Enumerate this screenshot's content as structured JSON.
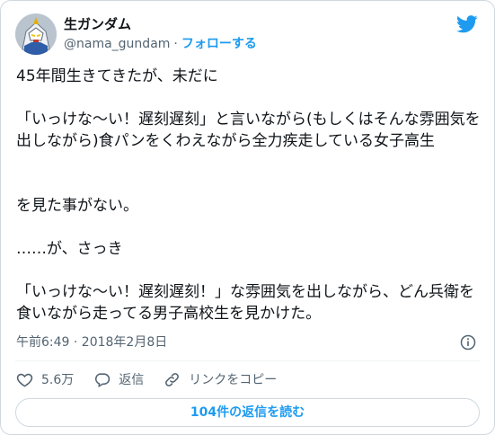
{
  "author": {
    "name": "生ガンダム",
    "handle": "@nama_gundam",
    "separator": "·",
    "follow_label": "フォローする"
  },
  "tweet": {
    "p1": "45年間生きてきたが、未だに",
    "p2": "「いっけな〜い！遅刻遅刻」と言いながら(もしくはそんな雰囲気を出しながら)食パンをくわえながら全力疾走している女子高生",
    "p3": "を見た事がない。",
    "p4": "……が、さっき",
    "p5": "「いっけな〜い！遅刻遅刻！」な雰囲気を出しながら、どん兵衛を食いながら走ってる男子高校生を見かけた。"
  },
  "meta": {
    "timestamp": "午前6:49 · 2018年2月8日"
  },
  "actions": {
    "like_count": "5.6万",
    "reply_label": "返信",
    "copy_link_label": "リンクをコピー"
  },
  "read_replies_label": "104件の返信を読む",
  "colors": {
    "accent": "#1d9bf0",
    "text": "#0f1419",
    "secondary": "#536471",
    "border": "#cfd9de"
  },
  "icons": [
    "avatar-image",
    "twitter-bird-icon",
    "info-icon",
    "heart-icon",
    "reply-icon",
    "link-icon"
  ]
}
